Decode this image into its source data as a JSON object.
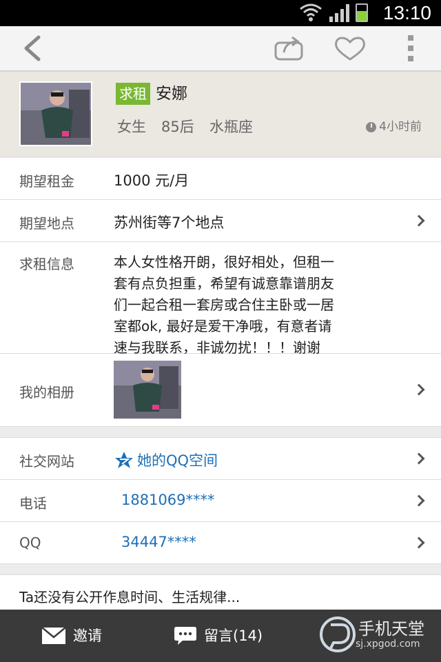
{
  "status": {
    "time": "13:10"
  },
  "topbar": {
    "icons": [
      "back-icon",
      "share-icon",
      "heart-icon",
      "more-icon"
    ]
  },
  "profile": {
    "tag": "求租",
    "name": "安娜",
    "gender": "女生",
    "age": "85后",
    "sign": "水瓶座",
    "posted": "4小时前"
  },
  "details": {
    "rent_label": "期望租金",
    "rent_value": "1000 元/月",
    "location_label": "期望地点",
    "location_value": "苏州街等7个地点",
    "info_label": "求租信息",
    "info_lines": [
      "本人女性格开朗，很好相处，但租一",
      "套有点负担重，希望有诚意靠谱朋友",
      "们一起合租一套房或合住主卧或一居",
      "室都ok, 最好是爱干净哦，有意者请",
      "速与我联系，非诚勿扰！！！谢谢"
    ],
    "album_label": "我的相册"
  },
  "contact": {
    "social_label": "社交网站",
    "social_value": "她的QQ空间",
    "phone_label": "电话",
    "phone_value": "1881069****",
    "qq_label": "QQ",
    "qq_value": "34447****"
  },
  "schedule_text": "Ta还没有公开作息时间、生活规律...",
  "bottom": {
    "invite": "邀请",
    "message": "留言(14)",
    "watermark_name": "手机天堂",
    "watermark_url": "sj.xpgod.com"
  },
  "colors": {
    "accent": "#7ab834",
    "link": "#1e6fb6"
  }
}
